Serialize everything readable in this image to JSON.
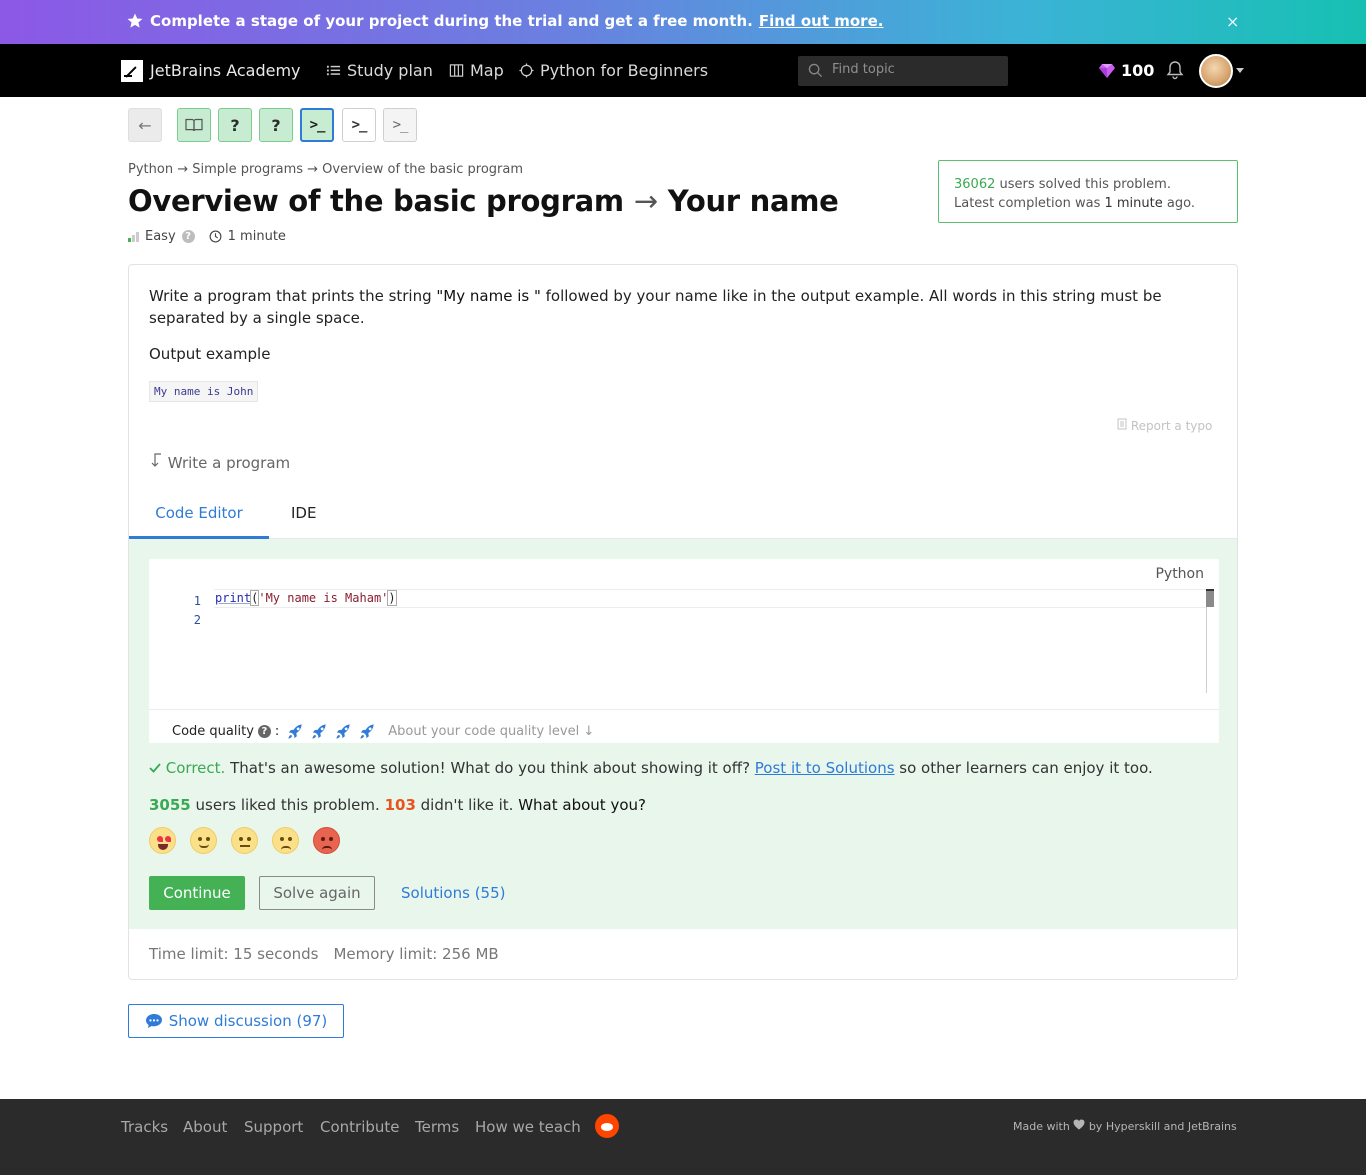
{
  "banner": {
    "text": "Complete a stage of your project during the trial and get a free month.",
    "link": "Find out more.",
    "close": "×"
  },
  "header": {
    "brand": "JetBrains Academy",
    "nav": [
      "Study plan",
      "Map",
      "Python for Beginners"
    ],
    "search_placeholder": "Find topic",
    "gems": "100"
  },
  "steps": {
    "back": "←",
    "theory_icon": "book-icon",
    "quiz1": "?",
    "quiz2": "?",
    "code": ">_"
  },
  "breadcrumb": "Python → Simple programs → Overview of the basic program",
  "title": {
    "topic": "Overview of the basic program",
    "arrow": "→",
    "problem": "Your name"
  },
  "meta": {
    "difficulty": "Easy",
    "time": "1 minute"
  },
  "stats": {
    "solved_count": "36062",
    "solved_text": "users solved this problem.",
    "latest_prefix": "Latest completion was",
    "latest_value": "1 minute",
    "latest_suffix": "ago."
  },
  "problem": {
    "desc_before": "Write a program that prints the string ",
    "desc_quote": "\"My name is \"",
    "desc_after": " followed by your name like in the output example. All words in this string must be separated by a single space.",
    "output_label": "Output example",
    "output_code": "My name is John",
    "report_typo": "Report a typo",
    "write_program": "Write a program"
  },
  "tabs": {
    "code_editor": "Code Editor",
    "ide": "IDE"
  },
  "editor": {
    "language": "Python",
    "line_numbers": [
      "1",
      "2"
    ],
    "code_kw": "print",
    "code_str": "'My name is Maham'",
    "code_quality_label": "Code quality",
    "code_quality_rating": 4,
    "code_quality_about": "About your code quality level ↓"
  },
  "result": {
    "correct": "Correct.",
    "message": " That's an awesome solution! What do you think about showing it off? ",
    "post_link": "Post it to Solutions",
    "message_end": " so other learners can enjoy it too."
  },
  "feedback": {
    "liked_count": "3055",
    "liked_text": " users liked this problem. ",
    "disliked_count": "103",
    "disliked_text": " didn't like it. ",
    "question": "What about you?"
  },
  "actions": {
    "continue": "Continue",
    "solve_again": "Solve again",
    "solutions": "Solutions (55)"
  },
  "limits": {
    "time": "Time limit: 15 seconds",
    "memory": "Memory limit: 256 MB"
  },
  "discussion": "Show discussion (97)",
  "footer": {
    "links": [
      "Tracks",
      "About",
      "Support",
      "Contribute",
      "Terms",
      "How we teach"
    ],
    "made_prefix": "Made with",
    "made_suffix": "by Hyperskill and JetBrains"
  },
  "colors": {
    "accent": "#2f7bd8",
    "success": "#45b155",
    "danger": "#e8531e"
  }
}
